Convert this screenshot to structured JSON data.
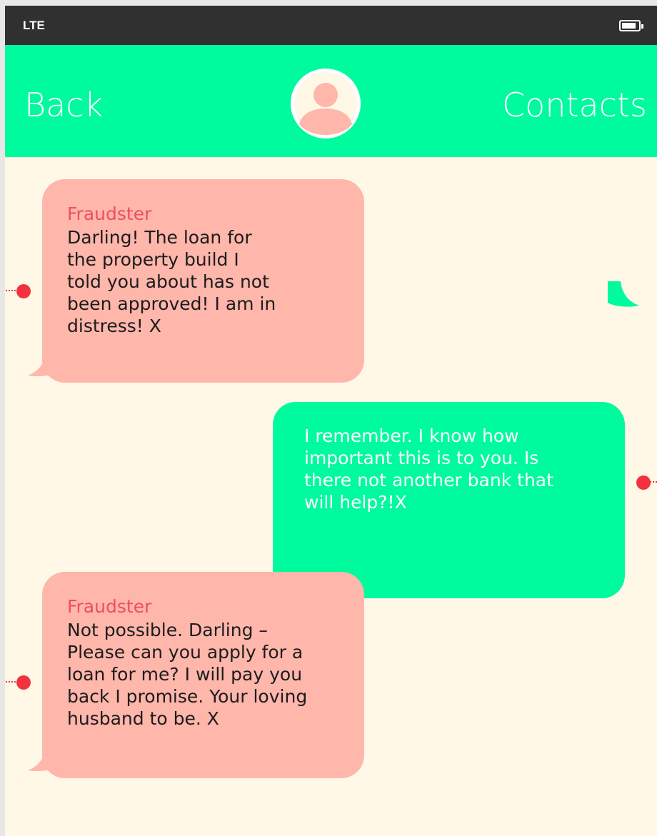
{
  "status_bar": {
    "network": "LTE",
    "battery_icon": "battery-icon"
  },
  "header": {
    "back_label": "Back",
    "contacts_label": "Contacts",
    "avatar_icon": "user-avatar-icon"
  },
  "colors": {
    "status_bar": "#303030",
    "header": "#00fa9e",
    "background": "#fff8e6",
    "incoming_bubble": "#ffb6ab",
    "outgoing_bubble": "#00fa9e",
    "sender_name": "#ef4f5d",
    "marker": "#f2333f"
  },
  "messages": [
    {
      "direction": "incoming",
      "sender": "Fraudster",
      "lines": [
        "Darling! The loan for",
        "the property build I",
        "told you about has not",
        "been approved! I am in",
        "distress! X"
      ]
    },
    {
      "direction": "outgoing",
      "lines": [
        "I remember. I know how",
        "important this is to you. Is",
        "there not another bank that",
        "will help?!X"
      ]
    },
    {
      "direction": "incoming",
      "sender": "Fraudster",
      "lines": [
        "Not possible. Darling –",
        "Please can you apply for a",
        "loan for me? I will pay you",
        "back I promise. Your loving",
        "husband to be. X"
      ]
    }
  ]
}
